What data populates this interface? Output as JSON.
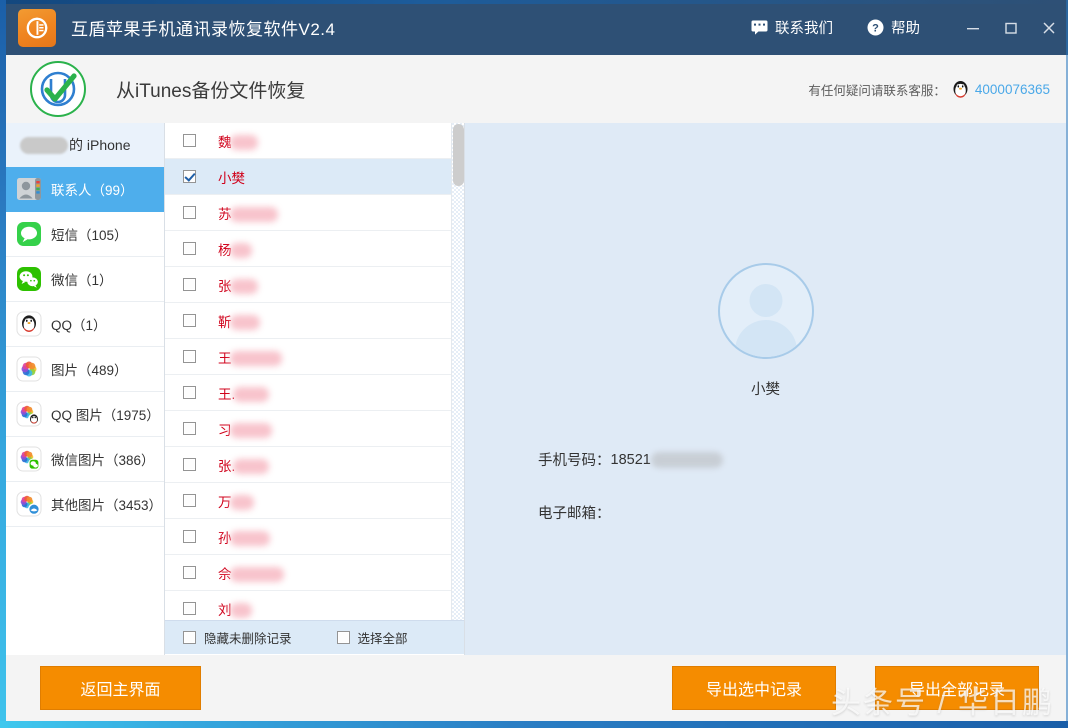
{
  "window": {
    "title": "互盾苹果手机通讯录恢复软件V2.4",
    "logo_icon": "app-logo-icon",
    "contact_us": "联系我们",
    "contact_us_icon": "chat-bubble-icon",
    "help": "帮助",
    "help_icon": "question-circle-icon",
    "minimize_icon": "minimize-icon",
    "maximize_icon": "maximize-icon",
    "close_icon": "close-icon",
    "titlebar_color": "#2e5075"
  },
  "subheader": {
    "badge_icon": "check-circle-icon",
    "title": "从iTunes备份文件恢复",
    "support_label": "有任何疑问请联系客服：",
    "support_qq_icon": "qq-penguin-icon",
    "support_phone": "4000076365",
    "phone_color": "#4aa8e8"
  },
  "sidebar": {
    "device_name_suffix": "的 iPhone",
    "items": [
      {
        "label": "联系人（99）",
        "icon": "contacts-icon",
        "active": true
      },
      {
        "label": "短信（105）",
        "icon": "messages-icon",
        "active": false
      },
      {
        "label": "微信（1）",
        "icon": "wechat-icon",
        "active": false
      },
      {
        "label": "QQ（1）",
        "icon": "qq-icon",
        "active": false
      },
      {
        "label": "图片（489）",
        "icon": "photos-icon",
        "active": false
      },
      {
        "label": "QQ 图片（1975）",
        "icon": "qq-photos-icon",
        "active": false
      },
      {
        "label": "微信图片（386）",
        "icon": "wechat-photos-icon",
        "active": false
      },
      {
        "label": "其他图片（3453）",
        "icon": "other-photos-icon",
        "active": false
      }
    ],
    "active_color": "#4eaeec"
  },
  "contact_list": {
    "rows": [
      {
        "name": "魏",
        "redact_width": 28,
        "checked": false,
        "selected": false
      },
      {
        "name": "小樊",
        "redact_width": 0,
        "checked": true,
        "selected": true
      },
      {
        "name": "苏",
        "redact_width": 48,
        "checked": false,
        "selected": false
      },
      {
        "name": "杨",
        "redact_width": 22,
        "checked": false,
        "selected": false
      },
      {
        "name": "张",
        "redact_width": 28,
        "checked": false,
        "selected": false
      },
      {
        "name": "靳",
        "redact_width": 30,
        "checked": false,
        "selected": false
      },
      {
        "name": "王",
        "redact_width": 52,
        "checked": false,
        "selected": false
      },
      {
        "name": "王.",
        "redact_width": 36,
        "checked": false,
        "selected": false
      },
      {
        "name": "习",
        "redact_width": 42,
        "checked": false,
        "selected": false
      },
      {
        "name": "张.",
        "redact_width": 36,
        "checked": false,
        "selected": false
      },
      {
        "name": "万",
        "redact_width": 24,
        "checked": false,
        "selected": false
      },
      {
        "name": "孙",
        "redact_width": 40,
        "checked": false,
        "selected": false
      },
      {
        "name": "佘",
        "redact_width": 54,
        "checked": false,
        "selected": false
      },
      {
        "name": "刘",
        "redact_width": 22,
        "checked": false,
        "selected": false
      }
    ],
    "name_color": "#d0021b",
    "footer": {
      "hide_undeleted": "隐藏未删除记录",
      "select_all": "选择全部",
      "hide_undeleted_checked": false,
      "select_all_checked": false
    }
  },
  "detail": {
    "avatar_icon": "person-avatar-icon",
    "name": "小樊",
    "phone_label": "手机号码：",
    "phone_value": "18521",
    "email_label": "电子邮箱：",
    "email_value": ""
  },
  "footer": {
    "back_button": "返回主界面",
    "export_selected_button": "导出选中记录",
    "export_all_button": "导出全部记录",
    "button_color": "#f58c00"
  },
  "watermark": {
    "text": "头条号 / 华日鹏"
  }
}
